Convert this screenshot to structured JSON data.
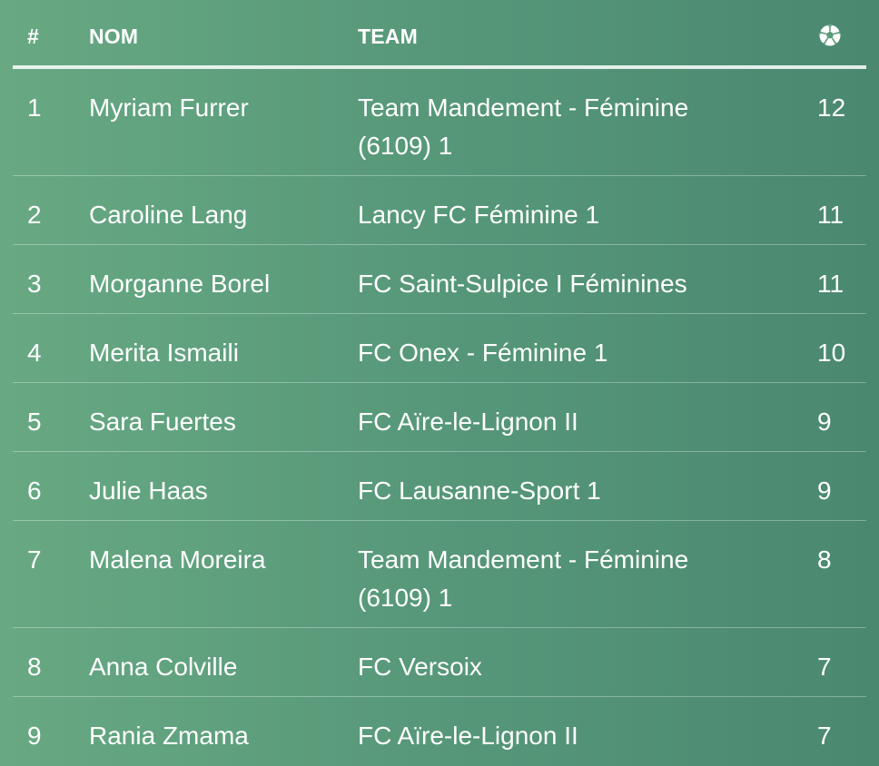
{
  "table": {
    "headers": {
      "rank": "#",
      "name": "NOM",
      "team": "TEAM",
      "goals_icon": "soccer-ball-icon"
    },
    "rows": [
      {
        "rank": "1",
        "name": "Myriam Furrer",
        "team": "Team Mandement - Féminine (6109) 1",
        "goals": "12"
      },
      {
        "rank": "2",
        "name": "Caroline Lang",
        "team": "Lancy FC Féminine 1",
        "goals": "11"
      },
      {
        "rank": "3",
        "name": "Morganne Borel",
        "team": "FC Saint-Sulpice I Féminines",
        "goals": "11"
      },
      {
        "rank": "4",
        "name": "Merita Ismaili",
        "team": "FC Onex - Féminine 1",
        "goals": "10"
      },
      {
        "rank": "5",
        "name": "Sara Fuertes",
        "team": "FC Aïre-le-Lignon II",
        "goals": "9"
      },
      {
        "rank": "6",
        "name": "Julie Haas",
        "team": "FC Lausanne-Sport 1",
        "goals": "9"
      },
      {
        "rank": "7",
        "name": "Malena Moreira",
        "team": "Team Mandement - Féminine (6109) 1",
        "goals": "8"
      },
      {
        "rank": "8",
        "name": "Anna Colville",
        "team": "FC Versoix",
        "goals": "7"
      },
      {
        "rank": "9",
        "name": "Rania Zmama",
        "team": "FC Aïre-le-Lignon II",
        "goals": "7"
      }
    ]
  }
}
